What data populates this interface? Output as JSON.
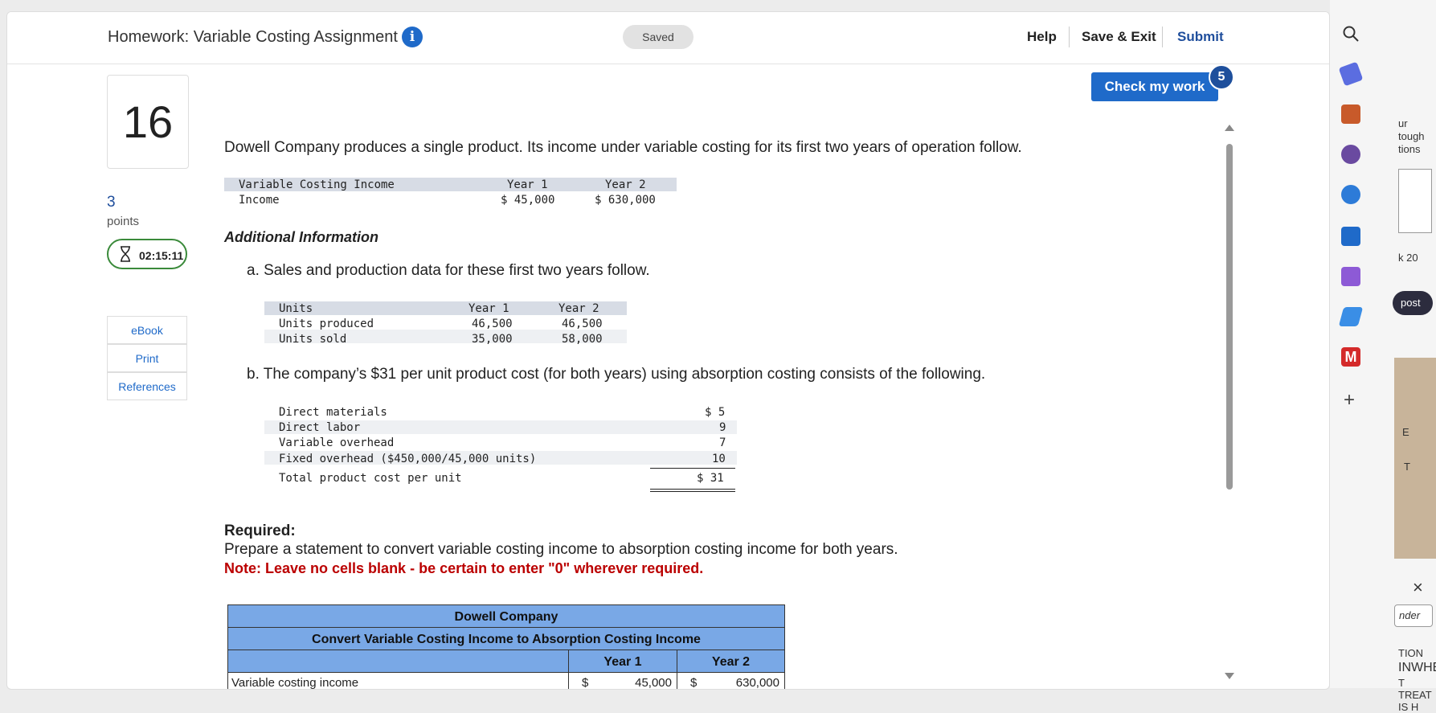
{
  "header": {
    "title": "Homework: Variable Costing Assignment",
    "saved_label": "Saved",
    "help_label": "Help",
    "save_exit_label": "Save & Exit",
    "submit_label": "Submit"
  },
  "question": {
    "number": "16",
    "points_value": "3",
    "points_label": "points",
    "timer": "02:15:11"
  },
  "resources": [
    "eBook",
    "Print",
    "References"
  ],
  "check_button": {
    "label": "Check my work",
    "badge": "5"
  },
  "intro": "Dowell Company produces a single product. Its income under variable costing for its first two years of operation follow.",
  "income_table": {
    "headers": [
      "Variable Costing Income",
      "Year 1",
      "Year 2"
    ],
    "row": [
      "Income",
      "$ 45,000",
      "$ 630,000"
    ]
  },
  "additional_info_heading": "Additional Information",
  "item_a": "a. Sales and production data for these first two years follow.",
  "units_table": {
    "headers": [
      "Units",
      "Year 1",
      "Year 2"
    ],
    "rows": [
      [
        "Units produced",
        "46,500",
        "46,500"
      ],
      [
        "Units sold",
        "35,000",
        "58,000"
      ]
    ]
  },
  "item_b": "b. The company’s $31 per unit product cost (for both years) using absorption costing consists of the following.",
  "cost_table": {
    "rows": [
      [
        "Direct materials",
        "$ 5"
      ],
      [
        "Direct labor",
        "9"
      ],
      [
        "Variable overhead",
        "7"
      ],
      [
        "Fixed overhead ($450,000/45,000 units)",
        "10"
      ]
    ],
    "total": [
      "Total product cost per unit",
      "$ 31"
    ]
  },
  "required_heading": "Required:",
  "required_text": "Prepare a statement to convert variable costing income to absorption costing income for both years.",
  "note": "Note: Leave no cells blank - be certain to enter \"0\" wherever required.",
  "answer_table": {
    "company": "Dowell Company",
    "subtitle": "Convert Variable Costing Income to Absorption Costing Income",
    "col_year1": "Year 1",
    "col_year2": "Year 2",
    "row_label": "Variable costing income",
    "cur1": "$",
    "val1": "45,000",
    "cur2": "$",
    "val2": "630,000"
  },
  "extension_panel": {
    "snippets": [
      "ur",
      "tough",
      "tions",
      "k 20",
      "post",
      "E",
      "T",
      "TION",
      "INWHEE",
      "T TREAT IS H"
    ],
    "badge_text": "nder"
  }
}
